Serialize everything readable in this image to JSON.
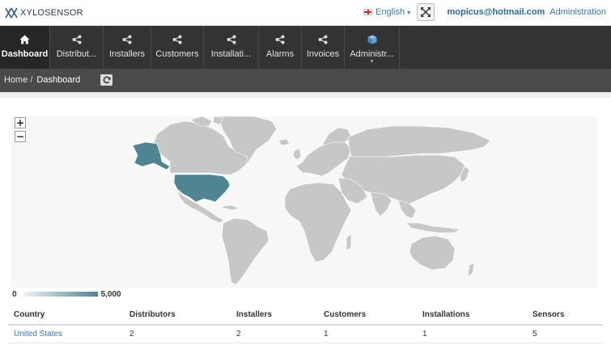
{
  "brand": {
    "name": "XYLOSENSOR"
  },
  "topbar": {
    "language": "English",
    "user_email": "mopicus@hotmail.com",
    "user_role": "Administration"
  },
  "nav": {
    "items": [
      {
        "label": "Dashboard",
        "icon": "home-icon",
        "active": true
      },
      {
        "label": "Distribut...",
        "icon": "share-icon"
      },
      {
        "label": "Installers",
        "icon": "share-icon"
      },
      {
        "label": "Customers",
        "icon": "share-icon"
      },
      {
        "label": "Installati...",
        "icon": "share-icon"
      },
      {
        "label": "Alarms",
        "icon": "share-icon"
      },
      {
        "label": "Invoices",
        "icon": "share-icon"
      },
      {
        "label": "Administr...",
        "icon": "cube-icon",
        "has_dropdown": true
      }
    ]
  },
  "breadcrumb": {
    "home": "Home",
    "separator": "/",
    "current": "Dashboard"
  },
  "map": {
    "zoom_in": "+",
    "zoom_out": "−",
    "highlight_color": "#4f8493",
    "land_color": "#c7c7c7",
    "highlighted_country": "United States"
  },
  "legend": {
    "min": "0",
    "max": "5,000"
  },
  "table": {
    "headers": [
      "Country",
      "Distributors",
      "Installers",
      "Customers",
      "Installations",
      "Sensors"
    ],
    "rows": [
      {
        "country": "United States",
        "distributors": "2",
        "installers": "2",
        "customers": "1",
        "installations": "1",
        "sensors": "5"
      }
    ]
  }
}
